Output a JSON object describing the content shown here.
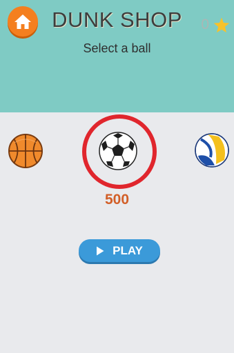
{
  "header": {
    "title": "DUNK SHOP",
    "subtitle": "Select a ball",
    "star_count": "0",
    "home_icon": "home-icon",
    "star_icon": "star-icon"
  },
  "carousel": {
    "balls": [
      {
        "name": "basketball",
        "icon": "basketball-icon",
        "selected": false
      },
      {
        "name": "soccer ball",
        "icon": "soccer-ball-icon",
        "selected": true
      },
      {
        "name": "volleyball",
        "icon": "volleyball-icon",
        "selected": false
      }
    ],
    "selected_price": "500"
  },
  "play": {
    "label": "PLAY",
    "icon": "play-icon"
  },
  "colors": {
    "header_bg": "#7fcbc4",
    "page_bg": "#e9eaed",
    "home_button": "#f47f1f",
    "selection_ring": "#e0262d",
    "price": "#d25f28",
    "play_button": "#3b9ad9",
    "star": "#f6c22b"
  }
}
